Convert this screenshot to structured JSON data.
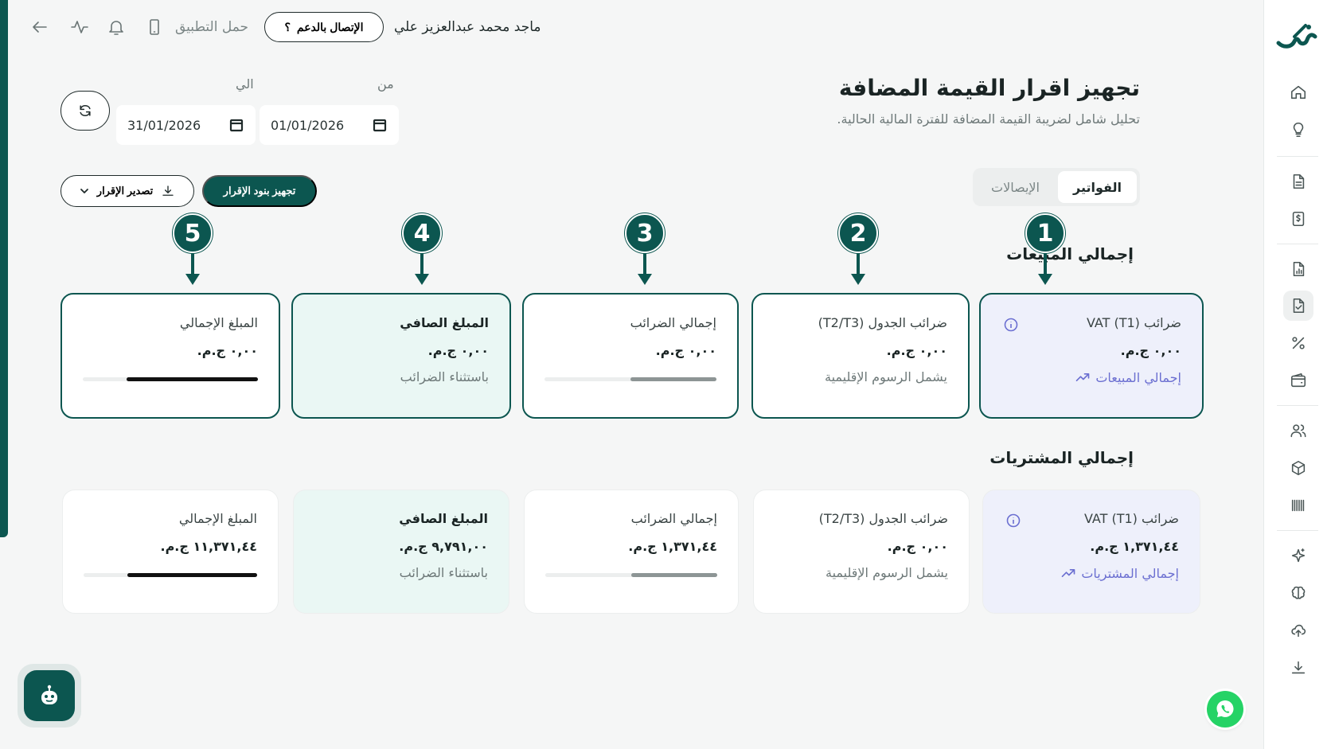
{
  "topbar": {
    "user_name": "ماجد محمد عبدالعزيز علي",
    "support_label": "الإتصال بالدعم",
    "support_glyph": "؟",
    "app_download": "حمل التطبيق"
  },
  "header": {
    "title": "تجهيز اقرار القيمة المضافة",
    "subtitle": "تحليل شامل لضريبة القيمة المضافة للفترة المالية الحالية."
  },
  "dates": {
    "from_label": "من",
    "from_value": "01/01/2026",
    "to_label": "الي",
    "to_value": "31/01/2026"
  },
  "tabs": [
    {
      "label": "الفواتير",
      "active": true
    },
    {
      "label": "الإيصالات",
      "active": false
    }
  ],
  "actions": {
    "prepare_label": "تجهيز بنود الإقرار",
    "export_label": "تصدير الإقرار"
  },
  "markers": [
    "1",
    "2",
    "3",
    "4",
    "5"
  ],
  "sales": {
    "title": "إجمالي المبيعات",
    "cards": [
      {
        "title": "ضرائب VAT (T1)",
        "value": "٠,٠٠ ج.م.",
        "link": "إجمالي المبيعات"
      },
      {
        "title": "ضرائب الجدول (T2/T3)",
        "value": "٠,٠٠ ج.م.",
        "note": "يشمل الرسوم الإقليمية"
      },
      {
        "title": "إجمالي الضرائب",
        "value": "٠,٠٠ ج.م.",
        "bar": 0.5
      },
      {
        "title": "المبلغ الصافي",
        "value": "٠,٠٠ ج.م.",
        "note": "باستثناء الضرائب"
      },
      {
        "title": "المبلغ الإجمالي",
        "value": "٠,٠٠ ج.م.",
        "bar": 0.75
      }
    ]
  },
  "purchases": {
    "title": "إجمالي المشتريات",
    "cards": [
      {
        "title": "ضرائب VAT (T1)",
        "value": "١,٣٧١,٤٤ ج.م.",
        "link": "إجمالي المشتريات"
      },
      {
        "title": "ضرائب الجدول (T2/T3)",
        "value": "٠,٠٠ ج.م.",
        "note": "يشمل الرسوم الإقليمية"
      },
      {
        "title": "إجمالي الضرائب",
        "value": "١,٣٧١,٤٤ ج.م.",
        "bar": 0.5
      },
      {
        "title": "المبلغ الصافي",
        "value": "٩,٧٩١,٠٠ ج.م.",
        "note": "باستثناء الضرائب"
      },
      {
        "title": "المبلغ الإجمالي",
        "value": "١١,٣٧١,٤٤ ج.م.",
        "bar": 0.75
      }
    ]
  },
  "colors": {
    "brand": "#0c5650",
    "link": "#6b6fd1",
    "blue_card": "#eef0fb",
    "mint_card": "#eaf7f4"
  },
  "icons": {
    "sidebar": [
      "home-icon",
      "lightbulb-icon",
      "document-icon",
      "invoice-dollar-icon",
      "report-chart-icon",
      "vat-return-icon",
      "percent-icon",
      "wallet-icon",
      "users-icon",
      "box-icon",
      "barcode-icon",
      "sparkle-icon",
      "brain-icon",
      "cloud-upload-icon",
      "download-icon"
    ]
  }
}
